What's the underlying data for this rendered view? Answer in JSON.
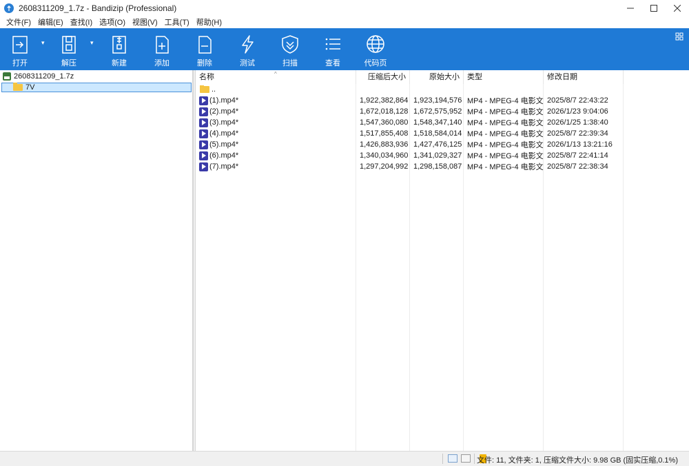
{
  "window": {
    "title": "2608311209_1.7z - Bandizip (Professional)",
    "controls": [
      "minimize",
      "maximize",
      "close"
    ]
  },
  "menu": [
    "文件(F)",
    "编辑(E)",
    "查找(I)",
    "选项(O)",
    "视图(V)",
    "工具(T)",
    "帮助(H)"
  ],
  "toolbar": {
    "buttons": [
      {
        "label": "打开",
        "icon": "open-icon"
      },
      {
        "label": "解压",
        "icon": "extract-icon"
      },
      {
        "label": "新建",
        "icon": "new-archive-icon"
      },
      {
        "label": "添加",
        "icon": "add-file-icon"
      },
      {
        "label": "删除",
        "icon": "delete-file-icon"
      },
      {
        "label": "测试",
        "icon": "test-lightning-icon"
      },
      {
        "label": "扫描",
        "icon": "scan-shield-icon"
      },
      {
        "label": "查看",
        "icon": "view-list-icon"
      },
      {
        "label": "代码页",
        "icon": "codepage-globe-icon"
      }
    ],
    "color": "#1f7ad6"
  },
  "tree": {
    "root": "2608311209_1.7z",
    "child": "7V"
  },
  "filelist": {
    "headers": {
      "name": "名称",
      "packed": "压缩后大小",
      "original": "原始大小",
      "type": "类型",
      "modified": "修改日期"
    },
    "parent": "..",
    "rows": [
      {
        "name": "(1).mp4*",
        "packed": "1,922,382,864",
        "original": "1,923,194,576",
        "type": "MP4 - MPEG-4 电影文...",
        "modified": "2025/8/7 22:43:22"
      },
      {
        "name": "(2).mp4*",
        "packed": "1,672,018,128",
        "original": "1,672,575,952",
        "type": "MP4 - MPEG-4 电影文...",
        "modified": "2026/1/23 9:04:06"
      },
      {
        "name": "(3).mp4*",
        "packed": "1,547,360,080",
        "original": "1,548,347,140",
        "type": "MP4 - MPEG-4 电影文...",
        "modified": "2026/1/25 1:38:40"
      },
      {
        "name": "(4).mp4*",
        "packed": "1,517,855,408",
        "original": "1,518,584,014",
        "type": "MP4 - MPEG-4 电影文...",
        "modified": "2025/8/7 22:39:34"
      },
      {
        "name": "(5).mp4*",
        "packed": "1,426,883,936",
        "original": "1,427,476,125",
        "type": "MP4 - MPEG-4 电影文...",
        "modified": "2026/1/13 13:21:16"
      },
      {
        "name": "(6).mp4*",
        "packed": "1,340,034,960",
        "original": "1,341,029,327",
        "type": "MP4 - MPEG-4 电影文...",
        "modified": "2025/8/7 22:41:14"
      },
      {
        "name": "(7).mp4*",
        "packed": "1,297,204,992",
        "original": "1,298,158,087",
        "type": "MP4 - MPEG-4 电影文...",
        "modified": "2025/8/7 22:38:34"
      }
    ]
  },
  "status": {
    "text": "文件: 11, 文件夹: 1, 压缩文件大小: 9.98 GB (固实压缩,0.1%)"
  }
}
